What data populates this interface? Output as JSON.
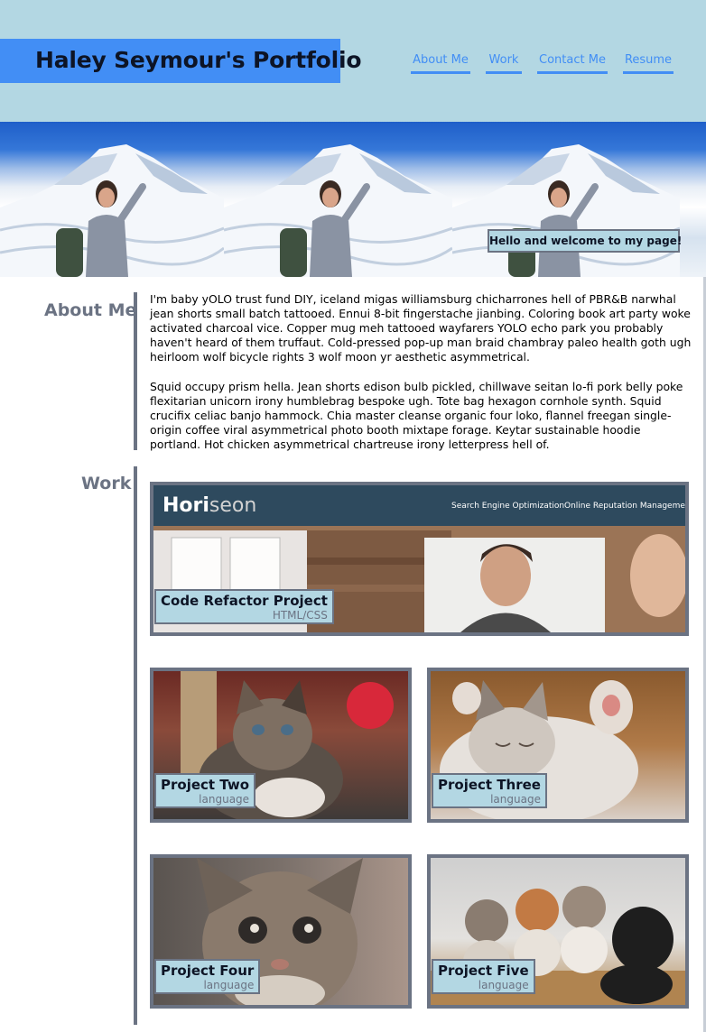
{
  "header": {
    "title": "Haley Seymour's Portfolio",
    "nav": [
      "About Me",
      "Work",
      "Contact Me",
      "Resume"
    ]
  },
  "hero": {
    "welcome": "Hello and welcome to my page!"
  },
  "about": {
    "heading": "About Me",
    "paragraphs": [
      "I'm baby yOLO trust fund DIY, iceland migas williamsburg chicharrones hell of PBR&B narwhal jean shorts small batch tattooed. Ennui 8-bit fingerstache jianbing. Coloring book art party woke activated charcoal vice. Copper mug meh tattooed wayfarers YOLO echo park you probably haven't heard of them truffaut. Cold-pressed pop-up man braid chambray paleo health goth ugh heirloom wolf bicycle rights 3 wolf moon yr aesthetic asymmetrical.",
      "Squid occupy prism hella. Jean shorts edison bulb pickled, chillwave seitan lo-fi pork belly poke flexitarian unicorn irony humblebrag bespoke ugh. Tote bag hexagon cornhole synth. Squid crucifix celiac banjo hammock. Chia master cleanse organic four loko, flannel freegan single-origin coffee viral asymmetrical photo booth mixtape forage. Keytar sustainable hoodie portland. Hot chicken asymmetrical chartreuse irony letterpress hell of."
    ]
  },
  "work": {
    "heading": "Work",
    "featured": {
      "title": "Code Refactor Project",
      "language": "HTML/CSS",
      "screenshot": {
        "logo": "Horiseon",
        "nav": [
          "Search Engine Optimization",
          "Online Reputation Management"
        ]
      }
    },
    "projects": [
      {
        "title": "Project Two",
        "language": "language"
      },
      {
        "title": "Project Three",
        "language": "language"
      },
      {
        "title": "Project Four",
        "language": "language"
      },
      {
        "title": "Project Five",
        "language": "language"
      }
    ]
  },
  "colors": {
    "header_bg": "#b3d7e3",
    "accent_blue": "#428ef5",
    "slate": "#6b7383",
    "title_text": "#0d1425"
  }
}
